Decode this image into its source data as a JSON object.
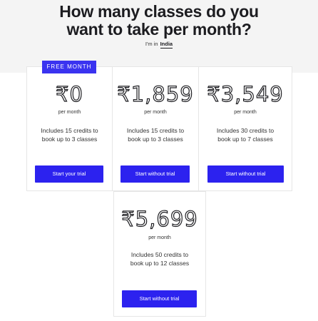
{
  "header": {
    "title_line1": "How many classes do you",
    "title_line2": "want to take per month?",
    "location_prefix": "I'm in",
    "location_country": "India"
  },
  "plans": [
    {
      "badge": "FREE MONTH",
      "price": "₹0",
      "period": "per month",
      "desc_line1": "Includes 15 credits to",
      "desc_line2": "book up to 3 classes",
      "button": "Start your trial"
    },
    {
      "price": "₹1,859",
      "period": "per month",
      "desc_line1": "Includes 15 credits to",
      "desc_line2": "book up to 3 classes",
      "button": "Start without trial"
    },
    {
      "price": "₹3,549",
      "period": "per month",
      "desc_line1": "Includes 30 credits to",
      "desc_line2": "book up to 7 classes",
      "button": "Start without trial"
    },
    {
      "price": "₹5,699",
      "period": "per month",
      "desc_line1": "Includes 50 credits to",
      "desc_line2": "book up to 12 classes",
      "button": "Start without trial"
    }
  ],
  "colors": {
    "accent": "#2c22ef",
    "badge": "#3a33f0",
    "hero_background": "#f4f4f4"
  }
}
